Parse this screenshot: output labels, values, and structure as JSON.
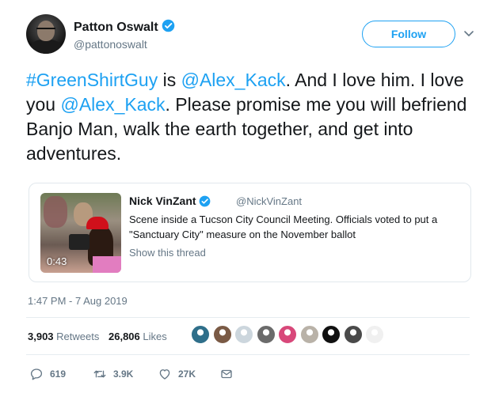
{
  "author": {
    "name": "Patton Oswalt",
    "handle": "@pattonoswalt"
  },
  "follow_label": "Follow",
  "tweet": {
    "parts": [
      {
        "text": "#GreenShirtGuy",
        "link": true
      },
      {
        "text": " is ",
        "link": false
      },
      {
        "text": "@Alex_Kack",
        "link": true
      },
      {
        "text": ". And I love him. I love you ",
        "link": false
      },
      {
        "text": "@Alex_Kack",
        "link": true
      },
      {
        "text": ". Please promise me you will befriend Banjo Man, walk the earth together, and get into adventures.",
        "link": false
      }
    ]
  },
  "quote": {
    "name": "Nick VinZant",
    "handle": "@NickVinZant",
    "text": "Scene inside a Tucson City Council Meeting. Officials voted to put a \"Sanctuary City\" measure on the November ballot",
    "show_thread": "Show this thread",
    "video_duration": "0:43"
  },
  "timestamp": "1:47 PM - 7 Aug 2019",
  "stats": {
    "retweets_count": "3,903",
    "retweets_label": "Retweets",
    "likes_count": "26,806",
    "likes_label": "Likes"
  },
  "likers": [
    {
      "name": "liker-avatar-1",
      "color": "#2f6f8a"
    },
    {
      "name": "liker-avatar-2",
      "color": "#7a5a45"
    },
    {
      "name": "liker-avatar-3",
      "color": "#ccd6dd"
    },
    {
      "name": "liker-avatar-4",
      "color": "#6b6b6b"
    },
    {
      "name": "liker-avatar-5",
      "color": "#d8487a"
    },
    {
      "name": "liker-avatar-6",
      "color": "#b9b2a8"
    },
    {
      "name": "liker-avatar-7",
      "color": "#111111"
    },
    {
      "name": "liker-avatar-8",
      "color": "#4a4a4a"
    },
    {
      "name": "liker-avatar-9",
      "color": "#f0f0f0"
    }
  ],
  "actions": {
    "replies": "619",
    "retweets": "3.9K",
    "likes": "27K"
  },
  "colors": {
    "accent": "#1da1f2",
    "text": "#14171a",
    "muted": "#657786",
    "border": "#e1e8ed"
  }
}
